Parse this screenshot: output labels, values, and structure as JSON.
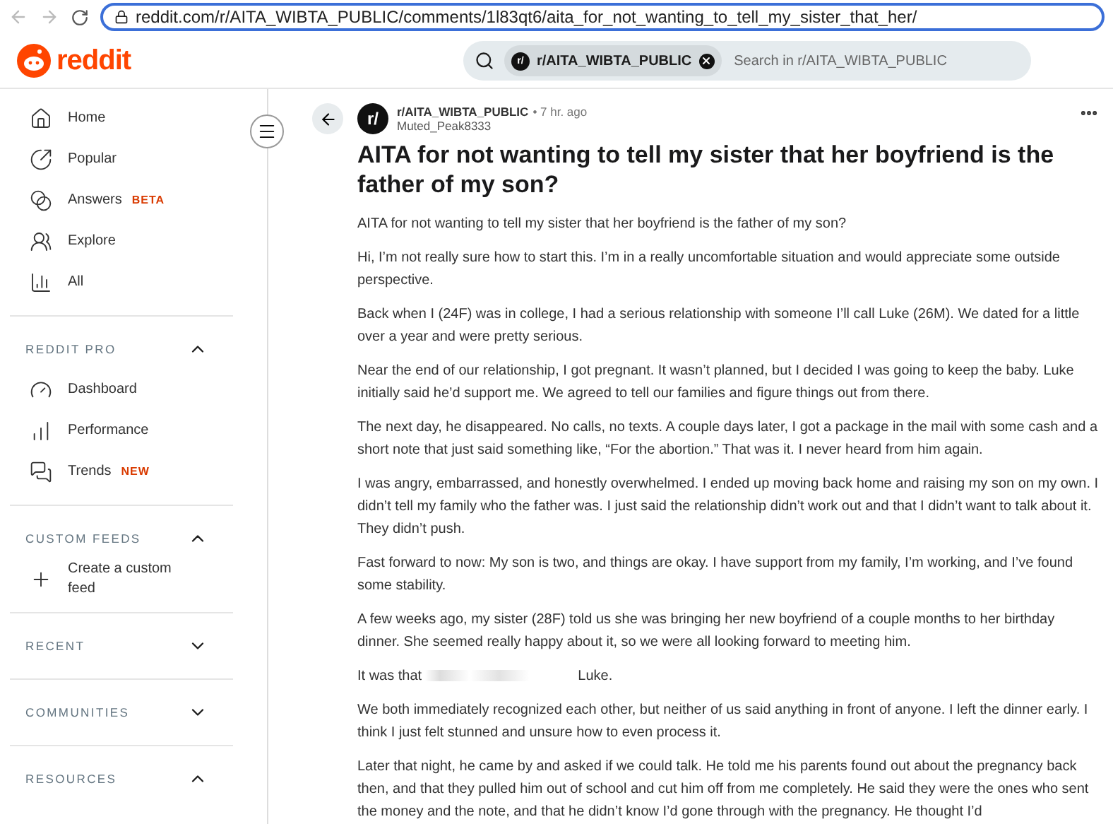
{
  "browser": {
    "url": "reddit.com/r/AITA_WIBTA_PUBLIC/comments/1l83qt6/aita_for_not_wanting_to_tell_my_sister_that_her/"
  },
  "header": {
    "logo": "reddit",
    "search": {
      "chip_avatar": "r/",
      "chip": "r/AITA_WIBTA_PUBLIC",
      "placeholder": "Search in r/AITA_WIBTA_PUBLIC"
    }
  },
  "sidebar": {
    "items": [
      {
        "label": "Home"
      },
      {
        "label": "Popular"
      },
      {
        "label": "Answers",
        "badge": "BETA"
      },
      {
        "label": "Explore"
      },
      {
        "label": "All"
      }
    ],
    "sections": [
      {
        "title": "REDDIT PRO",
        "expanded": true,
        "items": [
          {
            "label": "Dashboard"
          },
          {
            "label": "Performance"
          },
          {
            "label": "Trends",
            "badge": "NEW"
          }
        ]
      },
      {
        "title": "CUSTOM FEEDS",
        "expanded": true,
        "items": [
          {
            "label": "Create a custom feed"
          }
        ]
      },
      {
        "title": "RECENT",
        "expanded": false
      },
      {
        "title": "COMMUNITIES",
        "expanded": false
      },
      {
        "title": "RESOURCES",
        "expanded": true
      }
    ]
  },
  "post": {
    "avatar": "r/",
    "subreddit": "r/AITA_WIBTA_PUBLIC",
    "time": "• 7 hr. ago",
    "author": "Muted_Peak8333",
    "title": "AITA for not wanting to tell my sister that her boyfriend is the father of my son?",
    "paragraphs": [
      [
        "AITA for not wanting to tell my sister that her boyfriend is the father of my son?"
      ],
      [
        "Hi, I’m not really sure how to start this. I’m in a really uncomfortable situation and would appreciate some outside perspective."
      ],
      [
        "Back when I (24F) was in college, I had a serious relationship with someone I’ll call Luke (26M). We dated for a little over a year and were pretty serious."
      ],
      [
        "Near the end of our relationship, I got pregnant. It wasn’t planned, but I decided I was going to keep the baby. Luke initially said he’d support me. We agreed to tell our families and figure things out from there."
      ],
      [
        "The next day, he disappeared. No calls, no texts. A couple days later, I got a package in the mail with some cash and a short note that just said something like, “For the abortion.” That was it. I never heard from him again."
      ],
      [
        "I was angry, embarrassed, and honestly overwhelmed. I ended up moving back home and raising my son on my own. I didn’t tell my family who the father was. I just said the relationship didn’t work out and that I didn’t want to talk about it. They didn’t push."
      ],
      [
        "Fast forward to now: My son is two, and things are okay. I have support from my family, I’m working, and I’ve found some stability."
      ],
      [
        "A few weeks ago, my sister (28F) told us she was bringing her new boyfriend of a couple months to her birthday dinner. She seemed really happy about it, so we were all looking forward to meeting him."
      ],
      [
        "It was that",
        "Luke."
      ],
      [
        "We both immediately recognized each other, but neither of us said anything in front of anyone. I left the dinner early. I think I just felt stunned and unsure how to even process it."
      ],
      [
        "Later that night, he came by and asked if we could talk. He told me his parents found out about the pregnancy back then, and that they pulled him out of school and cut him off from me completely. He said they were the ones who sent the money and the note, and that he didn’t know I’d gone through with the pregnancy. He thought I’d"
      ]
    ]
  }
}
